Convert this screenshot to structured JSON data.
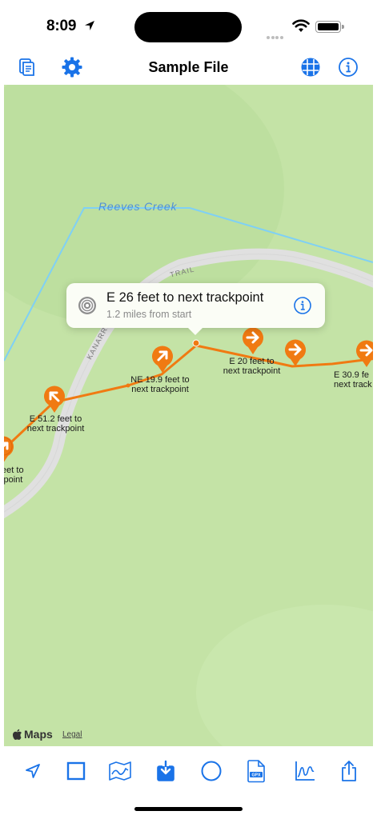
{
  "status_bar": {
    "time": "8:09"
  },
  "nav": {
    "title": "Sample File"
  },
  "map": {
    "creek_label": "Reeves Creek",
    "trail_label_1": "TRAIL",
    "trail_label_2": "KANARR",
    "callout": {
      "title": "E 26 feet to next trackpoint",
      "subtitle": "1.2 miles from start"
    },
    "waypoints": [
      {
        "label": "feet to\nkpoint"
      },
      {
        "label": "E 51.2 feet to\nnext trackpoint"
      },
      {
        "label": "NE 19.9 feet to\nnext trackpoint"
      },
      {
        "label": "E 20 feet to\nnext trackpoint"
      },
      {
        "label": ""
      },
      {
        "label": "E 30.9 fe\nnext track"
      }
    ],
    "attribution": "Maps",
    "legal": "Legal"
  },
  "colors": {
    "accent": "#1a73e8",
    "track": "#f07a12",
    "map_background": "#c4e3a6",
    "creek": "#7fd0f5"
  },
  "toolbar": {
    "gpx_badge": "GPX",
    "items": [
      "location-arrow-icon",
      "stop-icon",
      "map-icon",
      "import-icon",
      "circle-icon",
      "gpx-file-icon",
      "chart-icon",
      "share-icon"
    ]
  }
}
